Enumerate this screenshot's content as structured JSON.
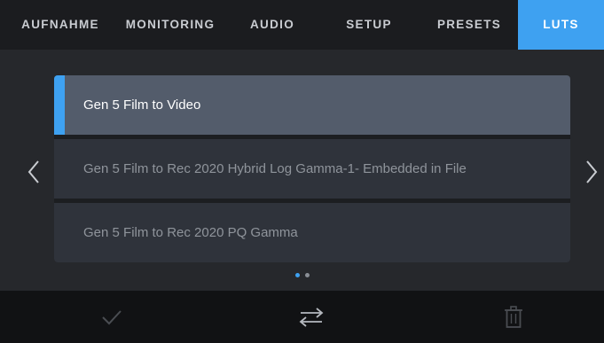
{
  "tabs": [
    {
      "label": "AUFNAHME",
      "active": false
    },
    {
      "label": "MONITORING",
      "active": false
    },
    {
      "label": "AUDIO",
      "active": false
    },
    {
      "label": "SETUP",
      "active": false
    },
    {
      "label": "PRESETS",
      "active": false
    },
    {
      "label": "LUTS",
      "active": true
    }
  ],
  "lut_list": {
    "items": [
      {
        "label": "Gen 5 Film to Video",
        "selected": true
      },
      {
        "label": "Gen 5 Film to Rec 2020 Hybrid Log Gamma-1- Embedded in File",
        "selected": false
      },
      {
        "label": "Gen 5 Film to Rec 2020 PQ Gamma",
        "selected": false
      }
    ]
  },
  "navigation": {
    "prev_icon": "chevron-left-icon",
    "next_icon": "chevron-right-icon",
    "page_count": 2,
    "current_page": 1
  },
  "bottom_bar": {
    "apply_icon": "checkmark-icon",
    "transfer_icon": "swap-arrows-icon",
    "delete_icon": "trash-icon"
  },
  "colors": {
    "accent": "#3ea1f1",
    "selected_row": "#535c6b",
    "row": "#2f333b"
  }
}
